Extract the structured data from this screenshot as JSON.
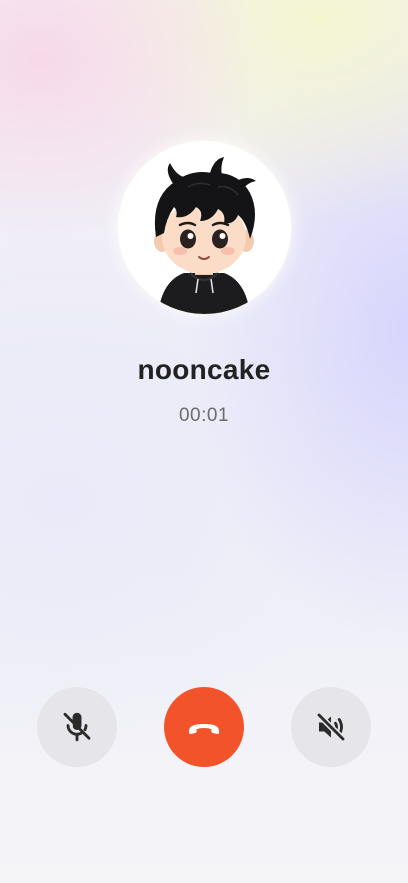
{
  "call": {
    "caller_name": "nooncake",
    "duration": "00:01"
  },
  "controls": {
    "mute_icon": "microphone-off-icon",
    "hangup_icon": "phone-hangup-icon",
    "speaker_icon": "speaker-off-icon"
  },
  "colors": {
    "hangup_red": "#f2532a",
    "control_gray": "#e6e6ea",
    "name_text": "#222222",
    "timer_text": "#6b6b6b"
  }
}
